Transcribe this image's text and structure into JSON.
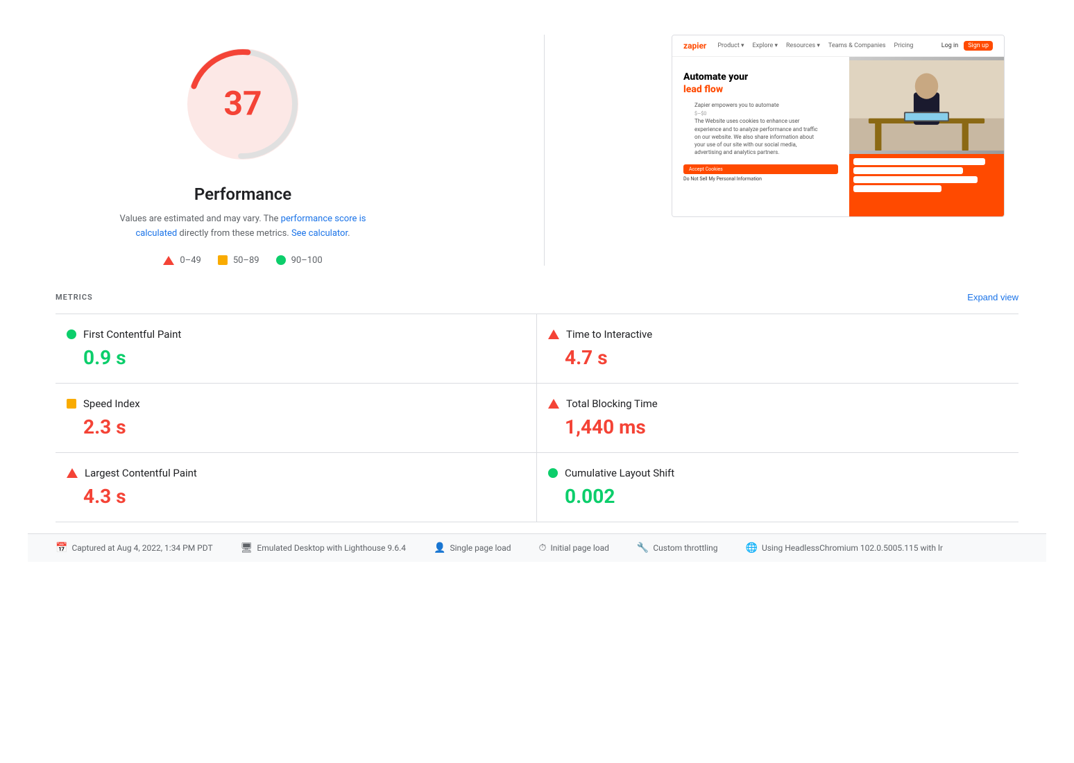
{
  "score": {
    "value": "37",
    "color": "#f44336"
  },
  "performance": {
    "title": "Performance",
    "description_prefix": "Values are estimated and may vary. The ",
    "description_link1": "performance score is calculated",
    "description_middle": " directly from these metrics. ",
    "description_link2": "See calculator",
    "description_suffix": "."
  },
  "legend": {
    "range1": "0–49",
    "range2": "50–89",
    "range3": "90–100"
  },
  "metrics": {
    "label": "METRICS",
    "expand_label": "Expand view",
    "items": [
      {
        "name": "First Contentful Paint",
        "value": "0.9 s",
        "indicator": "green-circle"
      },
      {
        "name": "Time to Interactive",
        "value": "4.7 s",
        "indicator": "red-triangle"
      },
      {
        "name": "Speed Index",
        "value": "2.3 s",
        "indicator": "orange-square"
      },
      {
        "name": "Total Blocking Time",
        "value": "1,440 ms",
        "indicator": "red-triangle"
      },
      {
        "name": "Largest Contentful Paint",
        "value": "4.3 s",
        "indicator": "red-triangle"
      },
      {
        "name": "Cumulative Layout Shift",
        "value": "0.002",
        "indicator": "green-circle"
      }
    ]
  },
  "footer": {
    "items": [
      {
        "icon": "calendar-icon",
        "text": "Captured at Aug 4, 2022, 1:34 PM PDT"
      },
      {
        "icon": "monitor-icon",
        "text": "Emulated Desktop with Lighthouse 9.6.4"
      },
      {
        "icon": "user-icon",
        "text": "Single page load"
      },
      {
        "icon": "clock-icon",
        "text": "Initial page load"
      },
      {
        "icon": "throttle-icon",
        "text": "Custom throttling"
      },
      {
        "icon": "chromium-icon",
        "text": "Using HeadlessChromium 102.0.5005.115 with lr"
      }
    ]
  }
}
